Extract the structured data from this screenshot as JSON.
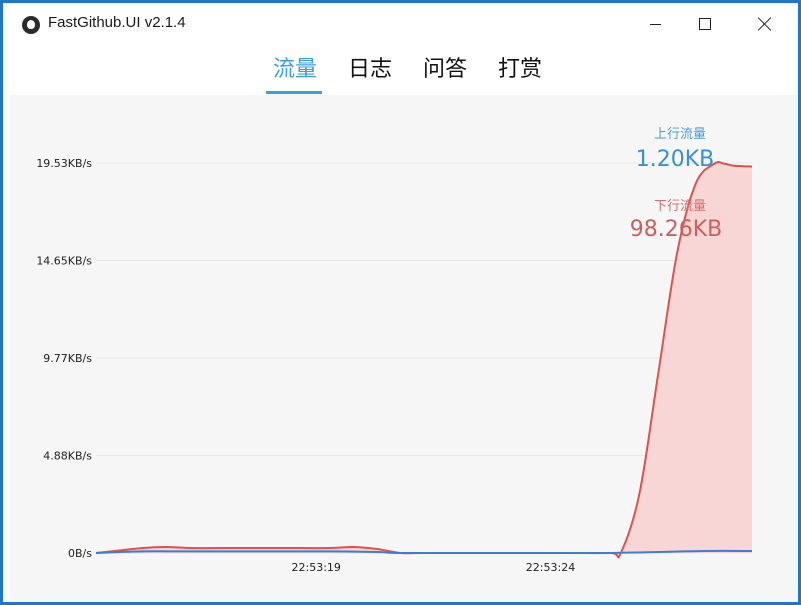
{
  "window": {
    "title": "FastGithub.UI v2.1.4"
  },
  "tabs": [
    {
      "label": "流量",
      "active": true
    },
    {
      "label": "日志",
      "active": false
    },
    {
      "label": "问答",
      "active": false
    },
    {
      "label": "打赏",
      "active": false
    }
  ],
  "legend": {
    "up_label": "上行流量",
    "up_value": "1.20KB",
    "down_label": "下行流量",
    "down_value": "98.26KB"
  },
  "colors": {
    "accent": "#3aa0dc",
    "upload": "#3a7fd0",
    "download": "#d9534f",
    "download_fill": "#f8d6d5"
  },
  "chart_data": {
    "type": "area",
    "y_ticks": [
      "0B/s",
      "4.88KB/s",
      "9.77KB/s",
      "14.65KB/s",
      "19.53KB/s"
    ],
    "y_tick_values": [
      0,
      4.88,
      9.77,
      14.65,
      19.53
    ],
    "ylim": [
      0,
      20
    ],
    "x_ticks": [
      "22:53:19",
      "22:53:24"
    ],
    "x_tick_values": [
      4.7,
      9.7
    ],
    "xlim": [
      0,
      14
    ],
    "grid": true,
    "series": [
      {
        "name": "下行流量",
        "x": [
          0,
          1,
          1.5,
          2,
          3,
          4,
          5,
          5.5,
          6,
          6.5,
          7,
          8,
          9,
          10,
          11,
          11.2,
          11.6,
          12,
          12.4,
          12.8,
          13.2,
          13.4,
          13.6,
          14
        ],
        "y": [
          0,
          0.25,
          0.3,
          0.25,
          0.25,
          0.25,
          0.25,
          0.3,
          0.2,
          0,
          0,
          0,
          0,
          0,
          0,
          0,
          3,
          9,
          15,
          18.5,
          19.5,
          19.5,
          19.4,
          19.35
        ]
      },
      {
        "name": "上行流量",
        "x": [
          0,
          1,
          2,
          4,
          5,
          6,
          6.5,
          8,
          10,
          11,
          12,
          13,
          14
        ],
        "y": [
          0,
          0.08,
          0.08,
          0.08,
          0.08,
          0.05,
          0,
          0,
          0,
          0,
          0.05,
          0.1,
          0.1
        ]
      }
    ]
  }
}
